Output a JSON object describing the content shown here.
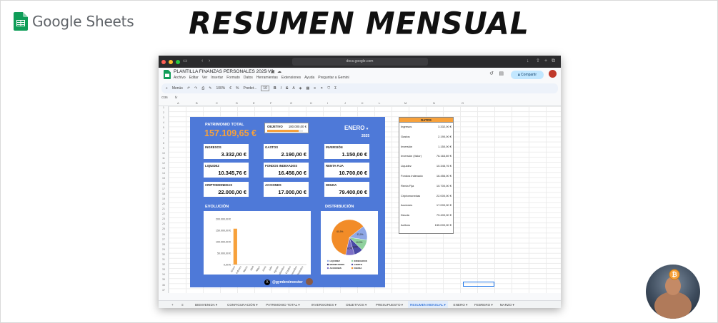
{
  "brand": {
    "name": "Google Sheets"
  },
  "headline": "RESUMEN MENSUAL",
  "colors": {
    "accent_orange": "#f7a13b",
    "dashboard_blue": "#4e79d8",
    "sheets_green": "#0f9d58"
  },
  "browser": {
    "url": "docs.google.com"
  },
  "app": {
    "doc_title": "PLANTILLA FINANZAS PERSONALES 2025 V3",
    "menus": [
      "Archivo",
      "Editar",
      "Ver",
      "Insertar",
      "Formato",
      "Datos",
      "Herramientas",
      "Extensiones",
      "Ayuda",
      "Preguntar a Gemini"
    ],
    "share_label": "Compartir",
    "toolbar": {
      "search": "Menús",
      "zoom": "100%",
      "format_currency": "€",
      "format_percent": "%",
      "font": "Predet...",
      "font_size": "10"
    },
    "cell_ref": "O36",
    "formula_prefix": "fx"
  },
  "columns": [
    "A",
    "B",
    "C",
    "D",
    "E",
    "F",
    "G",
    "H",
    "I",
    "J",
    "K",
    "L",
    "M",
    "N",
    "O"
  ],
  "rows": [
    "1",
    "2",
    "3",
    "4",
    "5",
    "6",
    "7",
    "8",
    "9",
    "10",
    "11",
    "12",
    "13",
    "14",
    "15",
    "16",
    "17",
    "18",
    "19",
    "20",
    "21",
    "22",
    "23",
    "24",
    "25",
    "26",
    "27",
    "28",
    "29",
    "30",
    "31",
    "32",
    "33",
    "34",
    "35",
    "36",
    "37"
  ],
  "dashboard": {
    "patrimonio_label": "PATRIMONIO TOTAL",
    "patrimonio_value": "157.109,65 €",
    "objetivo_label": "OBJETIVO",
    "objetivo_value": "180.000,00 €",
    "objetivo_progress": 0.873,
    "month": "ENERO",
    "month_caret": "▾",
    "year": "2025",
    "cards": [
      {
        "label": "INGRESOS",
        "value": "3.332,00 €"
      },
      {
        "label": "GASTOS",
        "value": "2.190,00 €"
      },
      {
        "label": "INVERSIÓN",
        "value": "1.150,00 €"
      },
      {
        "label": "LIQUIDEZ",
        "value": "10.345,76 €"
      },
      {
        "label": "FONDOS INDEXADOS",
        "value": "16.456,00 €"
      },
      {
        "label": "RENTA FIJA",
        "value": "10.700,00 €"
      },
      {
        "label": "CRIPTOMONEDAS",
        "value": "22.000,00 €"
      },
      {
        "label": "ACCIONES",
        "value": "17.000,00 €"
      },
      {
        "label": "DEUDA",
        "value": "79.400,00 €"
      }
    ],
    "evolucion_label": "EVOLUCIÓN",
    "distribucion_label": "DISTRIBUCIÓN",
    "footer_handle": "@gymbroinvestor"
  },
  "chart_data": [
    {
      "type": "bar",
      "categories": [
        "Enero",
        "Febrero",
        "Marzo",
        "Abril",
        "Mayo",
        "Junio",
        "Julio",
        "Agosto",
        "Septiembre",
        "Octubre",
        "Noviembre",
        "Diciembre"
      ],
      "values": [
        157109.65,
        0,
        0,
        0,
        0,
        0,
        0,
        0,
        0,
        0,
        0,
        0
      ],
      "yticks": [
        "0,00 €",
        "50.000,00 €",
        "100.000,00 €",
        "150.000,00 €",
        "200.000,00 €"
      ],
      "ylim": [
        0,
        200000
      ],
      "color": "#f7a13b"
    },
    {
      "type": "pie",
      "labels": [
        "LIQUIDEZ",
        "INDEXADOS",
        "MONETARIOS",
        "CRIPTO",
        "ACCIONES",
        "DEUDA"
      ],
      "values": [
        13.0,
        10.0,
        0,
        8.0,
        8.0,
        60.9
      ],
      "slice_labels": [
        "13,0%",
        "10,0%",
        "8,0%",
        "8,0%",
        "60,9%"
      ],
      "colors": [
        "#8fa7e6",
        "#8fd19e",
        "#f0f0f0",
        "#4a4aa6",
        "#7b6fc6",
        "#f28c28"
      ]
    }
  ],
  "side_table": {
    "header": "DATOS",
    "rows": [
      {
        "k": "Ingresos",
        "v": "3.332,00 €"
      },
      {
        "k": "Gastos",
        "v": "2.190,00 €"
      },
      {
        "k": "Inversión",
        "v": "1.150,00 €"
      },
      {
        "k": "Inversión (Valor)",
        "v": "76.163,89 €"
      },
      {
        "k": "Liquidez",
        "v": "10.345,76 €"
      },
      {
        "k": "Fondos indexado",
        "v": "16.456,00 €"
      },
      {
        "k": "Renta Fija",
        "v": "10.700,00 €"
      },
      {
        "k": "Criptomonedas",
        "v": "22.000,00 €"
      },
      {
        "k": "Acciones",
        "v": "17.000,00 €"
      },
      {
        "k": "Deuda",
        "v": "79.400,00 €"
      },
      {
        "k": "Activos",
        "v": "155.000,00 €"
      }
    ]
  },
  "tabs": [
    "BIENVENIDA",
    "CONFIGURACIÓN",
    "PATRIMONIO TOTAL",
    "INVERSIONES",
    "OBJETIVOS",
    "PRESUPUESTO",
    "RESUMEN MENSUAL",
    "ENERO",
    "FEBRERO",
    "MARZO"
  ],
  "active_tab": "RESUMEN MENSUAL"
}
